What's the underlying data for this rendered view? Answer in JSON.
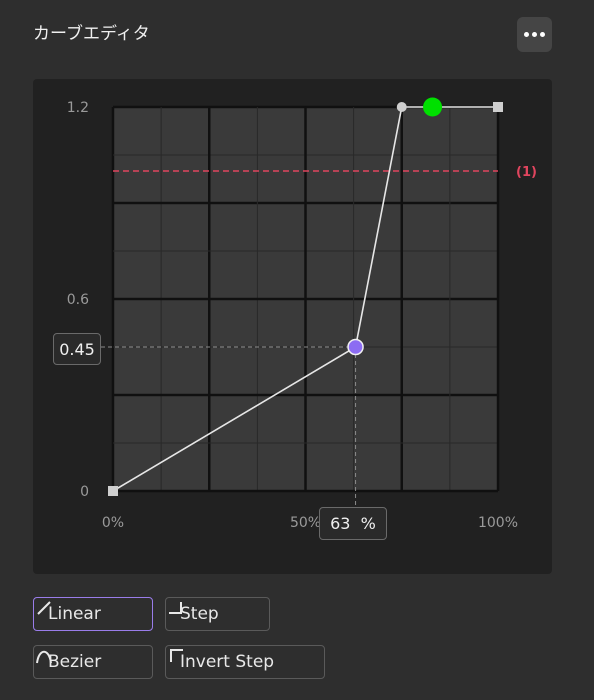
{
  "header": {
    "title": "カーブエディタ",
    "more_icon": "more-horizontal-icon"
  },
  "graph": {
    "y_ticks": [
      {
        "label": "1.2",
        "value": 1.2
      },
      {
        "label": "0.6",
        "value": 0.6
      },
      {
        "label": "0",
        "value": 0
      }
    ],
    "x_ticks": [
      {
        "label": "0%",
        "value": 0
      },
      {
        "label": "50%",
        "value": 50
      },
      {
        "label": "100%",
        "value": 100
      }
    ],
    "x_range": [
      0,
      100
    ],
    "y_range": [
      0,
      1.2
    ],
    "reference_line": {
      "value": 1.0,
      "label": "(1)",
      "color": "#e0455e"
    },
    "curve_points": [
      {
        "x": 0,
        "y": 0,
        "kind": "square"
      },
      {
        "x": 63,
        "y": 0.45,
        "kind": "selected"
      },
      {
        "x": 75,
        "y": 1.2,
        "kind": "dot"
      },
      {
        "x": 100,
        "y": 1.2,
        "kind": "square"
      }
    ],
    "handle": {
      "x": 83,
      "y": 1.2,
      "color": "#00e000"
    },
    "selected": {
      "y_value": "0.45",
      "x_value": "63",
      "x_unit": "%",
      "color": "#8c6cf2"
    }
  },
  "modes": [
    {
      "label": "Linear",
      "icon": "linear-icon",
      "active": true
    },
    {
      "label": "Step",
      "icon": "step-icon",
      "active": false
    },
    {
      "label": "Bezier",
      "icon": "bezier-icon",
      "active": false
    },
    {
      "label": "Invert Step",
      "icon": "invert-step-icon",
      "active": false
    }
  ]
}
